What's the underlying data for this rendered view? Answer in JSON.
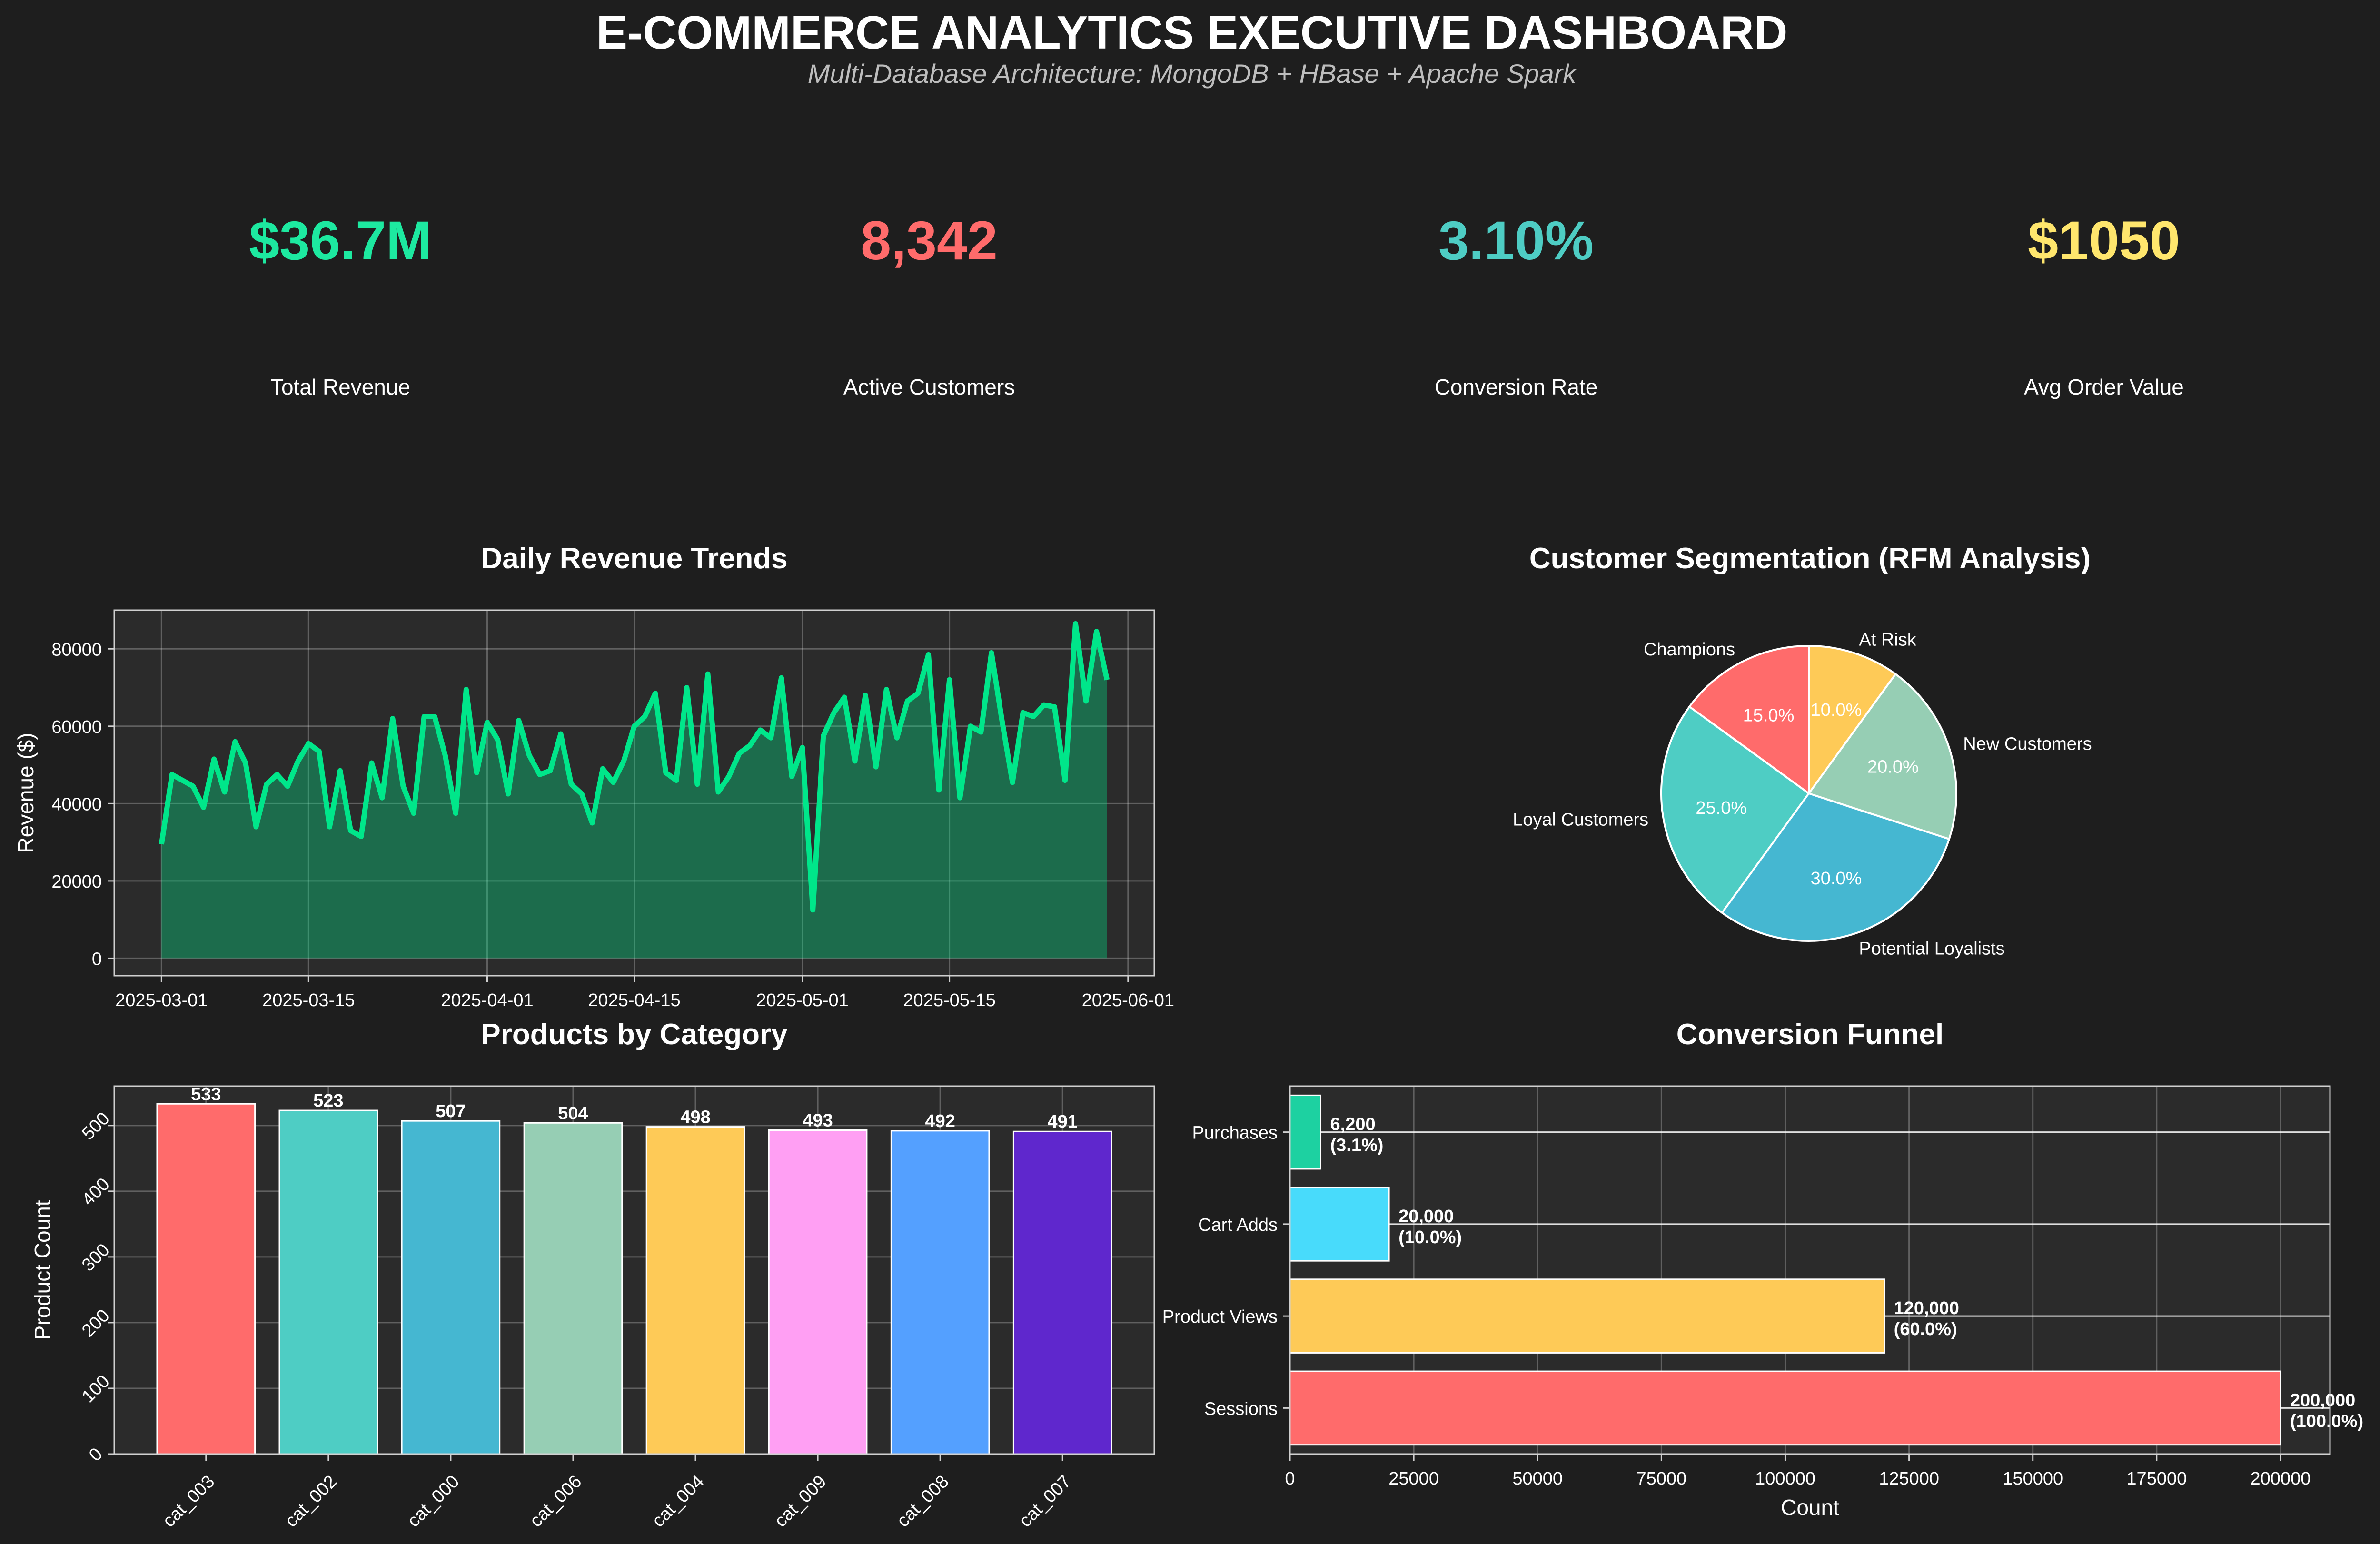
{
  "header": {
    "title": "E-COMMERCE ANALYTICS EXECUTIVE DASHBOARD",
    "subtitle": "Multi-Database Architecture: MongoDB + HBase + Apache Spark"
  },
  "kpis": [
    {
      "value": "$36.7M",
      "label": "Total Revenue",
      "color": "#1de9a0"
    },
    {
      "value": "8,342",
      "label": "Active Customers",
      "color": "#ff6b6b"
    },
    {
      "value": "3.10%",
      "label": "Conversion Rate",
      "color": "#4ecdc4"
    },
    {
      "value": "$1050",
      "label": "Avg Order Value",
      "color": "#ffe66d"
    }
  ],
  "chart_data": [
    {
      "type": "area",
      "title": "Daily Revenue Trends",
      "xlabel": "",
      "ylabel": "Revenue ($)",
      "x_start": "2025-03-01",
      "x_end": "2025-05-30",
      "xticks": [
        "2025-03-01",
        "2025-03-15",
        "2025-04-01",
        "2025-04-15",
        "2025-05-01",
        "2025-05-15",
        "2025-06-01"
      ],
      "ylim": [
        -4500,
        90000
      ],
      "yticks": [
        0,
        20000,
        40000,
        60000,
        80000
      ],
      "grid": true,
      "color": "#00e68a",
      "values": [
        29500,
        47500,
        46000,
        44500,
        39000,
        51500,
        43000,
        56000,
        50500,
        34000,
        45000,
        47500,
        44500,
        51000,
        55500,
        53500,
        34000,
        48500,
        33000,
        31500,
        50500,
        41500,
        62000,
        44500,
        37500,
        62500,
        62500,
        52500,
        37500,
        69500,
        48000,
        61000,
        56500,
        42500,
        61500,
        52500,
        47500,
        48500,
        58000,
        45000,
        42500,
        35000,
        49000,
        45500,
        51000,
        60000,
        62500,
        68500,
        48000,
        46000,
        70000,
        45000,
        73500,
        43000,
        47000,
        53000,
        55000,
        59000,
        57000,
        72500,
        47000,
        54500,
        12500,
        57500,
        63500,
        67500,
        51000,
        68000,
        49500,
        69500,
        57000,
        66500,
        68500,
        78500,
        43500,
        72000,
        41500,
        60000,
        58500,
        79000,
        61500,
        45500,
        63500,
        62500,
        65500,
        65000,
        46000,
        86500,
        66500,
        84500,
        72000
      ]
    },
    {
      "type": "pie",
      "title": "Customer Segmentation (RFM Analysis)",
      "labels": [
        "Champions",
        "Loyal Customers",
        "Potential Loyalists",
        "New Customers",
        "At Risk"
      ],
      "values": [
        15.0,
        25.0,
        30.0,
        20.0,
        10.0
      ],
      "value_labels": [
        "15.0%",
        "25.0%",
        "30.0%",
        "20.0%",
        "10.0%"
      ],
      "colors": [
        "#ff6b6b",
        "#4ecdc4",
        "#45b7d1",
        "#96ceb4",
        "#feca57"
      ],
      "start_angle_deg": 90,
      "direction": "counterclockwise"
    },
    {
      "type": "bar",
      "title": "Products by Category",
      "xlabel": "",
      "ylabel": "Product Count",
      "categories": [
        "cat_003",
        "cat_002",
        "cat_000",
        "cat_006",
        "cat_004",
        "cat_009",
        "cat_008",
        "cat_007"
      ],
      "values": [
        533,
        523,
        507,
        504,
        498,
        493,
        492,
        491
      ],
      "colors": [
        "#ff6b6b",
        "#4ecdc4",
        "#45b7d1",
        "#96ceb4",
        "#feca57",
        "#ff9ff3",
        "#54a0ff",
        "#5f27cd"
      ],
      "ylim": [
        0,
        560
      ],
      "yticks": [
        0,
        100,
        200,
        300,
        400,
        500
      ],
      "grid": true
    },
    {
      "type": "bar",
      "orientation": "horizontal",
      "title": "Conversion Funnel",
      "xlabel": "Count",
      "ylabel": "",
      "categories": [
        "Sessions",
        "Product Views",
        "Cart Adds",
        "Purchases"
      ],
      "values": [
        200000,
        120000,
        20000,
        6200
      ],
      "value_labels": [
        "200,000",
        "120,000",
        "20,000",
        "6,200"
      ],
      "percent_labels": [
        "(100.0%)",
        "(60.0%)",
        "(10.0%)",
        "(3.1%)"
      ],
      "colors": [
        "#ff6b6b",
        "#feca57",
        "#48dbfb",
        "#1dd1a1"
      ],
      "xlim": [
        0,
        210000
      ],
      "xticks": [
        0,
        25000,
        50000,
        75000,
        100000,
        125000,
        150000,
        175000,
        200000
      ],
      "grid": true
    }
  ]
}
